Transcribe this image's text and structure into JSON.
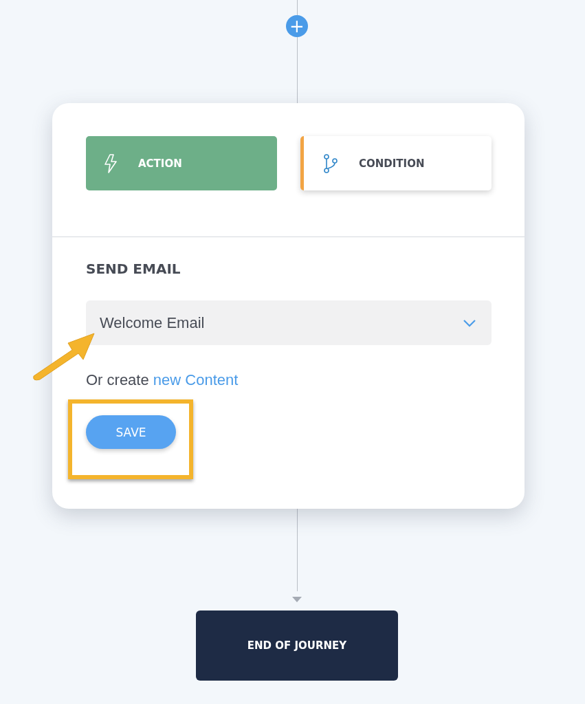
{
  "add_step": {
    "label": "+"
  },
  "step_types": [
    {
      "label": "ACTION",
      "kind": "action",
      "selected": true
    },
    {
      "label": "CONDITION",
      "kind": "condition",
      "selected": false
    }
  ],
  "section_title": "SEND EMAIL",
  "content_select": {
    "value": "Welcome Email"
  },
  "create_hint": {
    "text": "Or create",
    "link": "new Content"
  },
  "save_button": "SAVE",
  "end_node": "END OF JOURNEY"
}
